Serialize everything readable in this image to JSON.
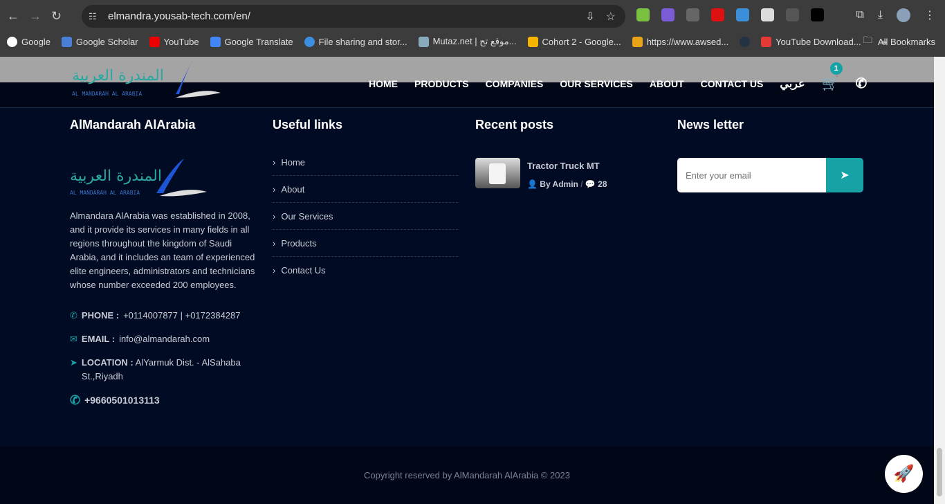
{
  "browser": {
    "url": "elmandra.yousab-tech.com/en/",
    "bookmarks": [
      "Google",
      "Google Scholar",
      "YouTube",
      "Google Translate",
      "File sharing and stor...",
      "Mutaz.net | موقع تح...",
      "Cohort 2 - Google...",
      "https://www.awsed...",
      "",
      "YouTube Download..."
    ],
    "all_bookmarks": "All Bookmarks",
    "more": "»"
  },
  "header": {
    "logo_text": "المندرة العربية AL MANDARAH AL ARABIA",
    "nav": [
      "HOME",
      "PRODUCTS",
      "COMPANIES",
      "OUR SERVICES",
      "ABOUT",
      "CONTACT US"
    ],
    "lang": "عربي",
    "cart_count": "1"
  },
  "about": {
    "title": "AlMandarah AlArabia",
    "text": "Almandara AlArabia was established in 2008, and it provide its services in many fields in all regions throughout the kingdom of Saudi Arabia, and it includes an team of experienced elite engineers, administrators and technicians whose number exceeded 200 employees.",
    "phone_label": "PHONE :",
    "phone": "+0114007877 | +0172384287",
    "email_label": "EMAIL :",
    "email": "info@almandarah.com",
    "location_label": "LOCATION :",
    "location": "AlYarmuk Dist. - AlSahaba St.,Riyadh",
    "whatsapp": "+9660501013113"
  },
  "links": {
    "title": "Useful links",
    "items": [
      "Home",
      "About",
      "Our Services",
      "Products",
      "Contact Us"
    ]
  },
  "posts": {
    "title": "Recent posts",
    "items": [
      {
        "title": "Tractor Truck MT",
        "author": "By Admin",
        "comments": "28"
      }
    ]
  },
  "newsletter": {
    "title": "News letter",
    "placeholder": "Enter your email"
  },
  "copyright": "Copyright reserved by AlMandarah AlArabia © 2023",
  "colors": {
    "accent": "#17a2a6",
    "background": "#020b24"
  }
}
